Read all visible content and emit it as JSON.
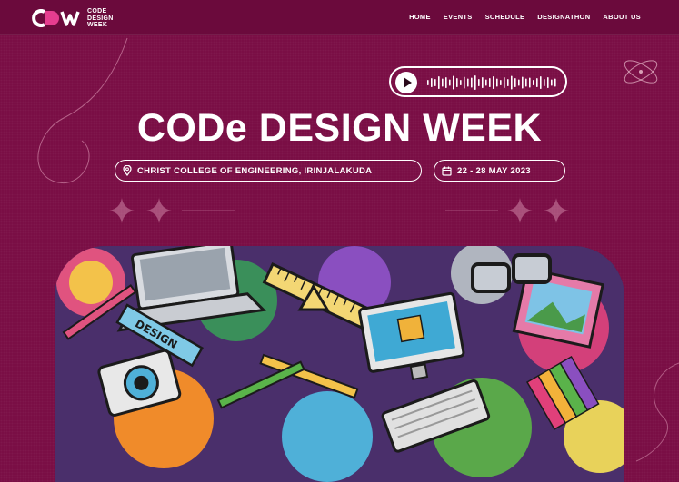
{
  "header": {
    "logo_lines": [
      "CODE",
      "DESIGN",
      "WEEK"
    ],
    "logo_mark": "CDW",
    "nav": [
      "HOME",
      "EVENTS",
      "SCHEDULE",
      "DESIGNATHON",
      "ABOUT US"
    ]
  },
  "audio_player": {
    "icon": "play-icon"
  },
  "hero": {
    "title": "CODe DESIGN WEEK",
    "venue": "CHRIST COLLEGE OF ENGINEERING, IRINJALAKUDA",
    "dates": "22 - 28 MAY 2023"
  },
  "illustration": {
    "label": "DESIGN"
  },
  "colors": {
    "background": "#7a0e45",
    "header": "#6b0a3c",
    "accent": "#e53d8f"
  }
}
